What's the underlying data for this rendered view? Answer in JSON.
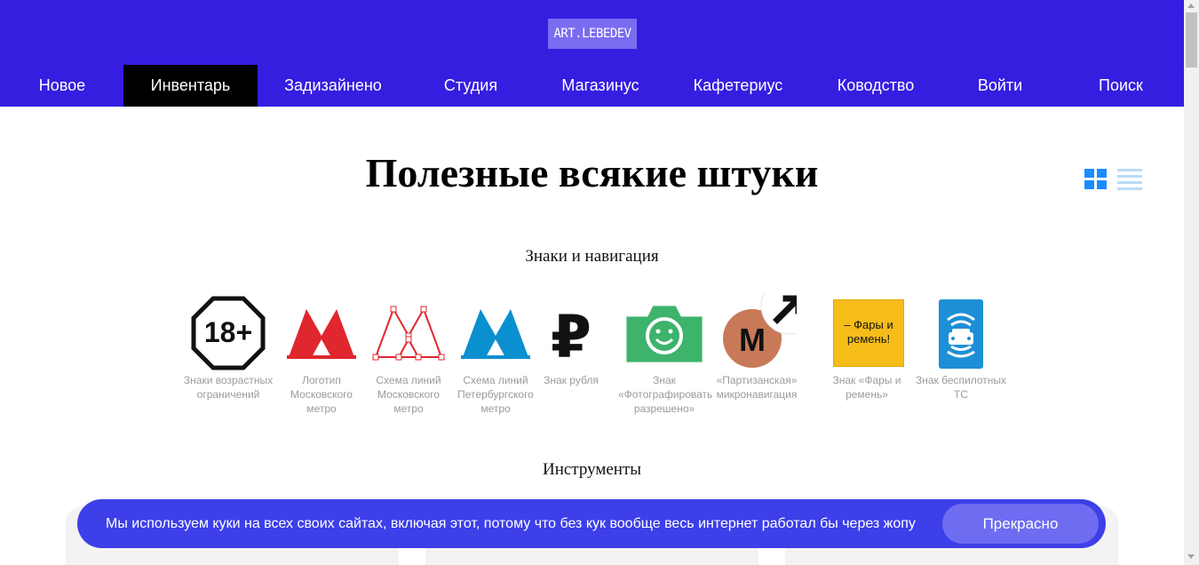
{
  "header": {
    "logo_text": "ART.LEBEDEV",
    "nav": [
      {
        "label": "Новое"
      },
      {
        "label": "Инвентарь"
      },
      {
        "label": "Задизайнено"
      },
      {
        "label": "Студия"
      },
      {
        "label": "Магазинус"
      },
      {
        "label": "Кафетериус"
      },
      {
        "label": "Ководство"
      },
      {
        "label": "Войти"
      },
      {
        "label": "Поиск"
      }
    ],
    "active_nav": "Инвентарь"
  },
  "page": {
    "title": "Полезные всякие штуки",
    "view_toggle": {
      "grid": "grid-view-icon",
      "list": "list-view-icon",
      "selected": "grid"
    }
  },
  "sections": {
    "signs_title": "Знаки и навигация",
    "tools_title": "Инструменты"
  },
  "signs": [
    {
      "caption": "Знаки возрастных ограничений",
      "icon": "age-rating-18-icon",
      "icon_text": "18+"
    },
    {
      "caption": "Логотип Московского метро",
      "icon": "moscow-metro-logo-icon"
    },
    {
      "caption": "Схема линий Московского метро",
      "icon": "moscow-metro-lines-scheme-icon"
    },
    {
      "caption": "Схема линий Петербургского метро",
      "icon": "petersburg-metro-lines-icon"
    },
    {
      "caption": "Знак рубля",
      "icon": "ruble-sign-icon",
      "icon_text": "₽"
    },
    {
      "caption": "Знак «Фотографировать разрешено»",
      "icon": "photo-allowed-camera-icon"
    },
    {
      "caption": "«Партизанская» микронавигация",
      "icon": "partizanskaya-micronavigation-icon",
      "icon_text": "М"
    },
    {
      "caption": "Знак «Фары и ремень»",
      "icon": "headlights-seatbelt-sign-icon",
      "icon_text": "– Фары и ремень!"
    },
    {
      "caption": "Знак беспилотных ТС",
      "icon": "driverless-vehicle-sign-icon"
    }
  ],
  "colors": {
    "header_bg": "#351ee0",
    "logo_bg": "#7a6cf0",
    "metro_red": "#e0262e",
    "metro_blue": "#0a8fd0",
    "camera_green": "#3db36c",
    "fary_yellow": "#f6bd1a",
    "driverless_blue": "#1d8fd6",
    "partizan_brown": "#c87a58",
    "cookie_bg": "#3d3fe8",
    "cookie_btn": "#6e6cf1"
  },
  "cookie": {
    "text": "Мы используем куки на всех своих сайтах, включая этот, потому что без кук вообще весь интернет работал бы через жопу",
    "button": "Прекрасно"
  }
}
